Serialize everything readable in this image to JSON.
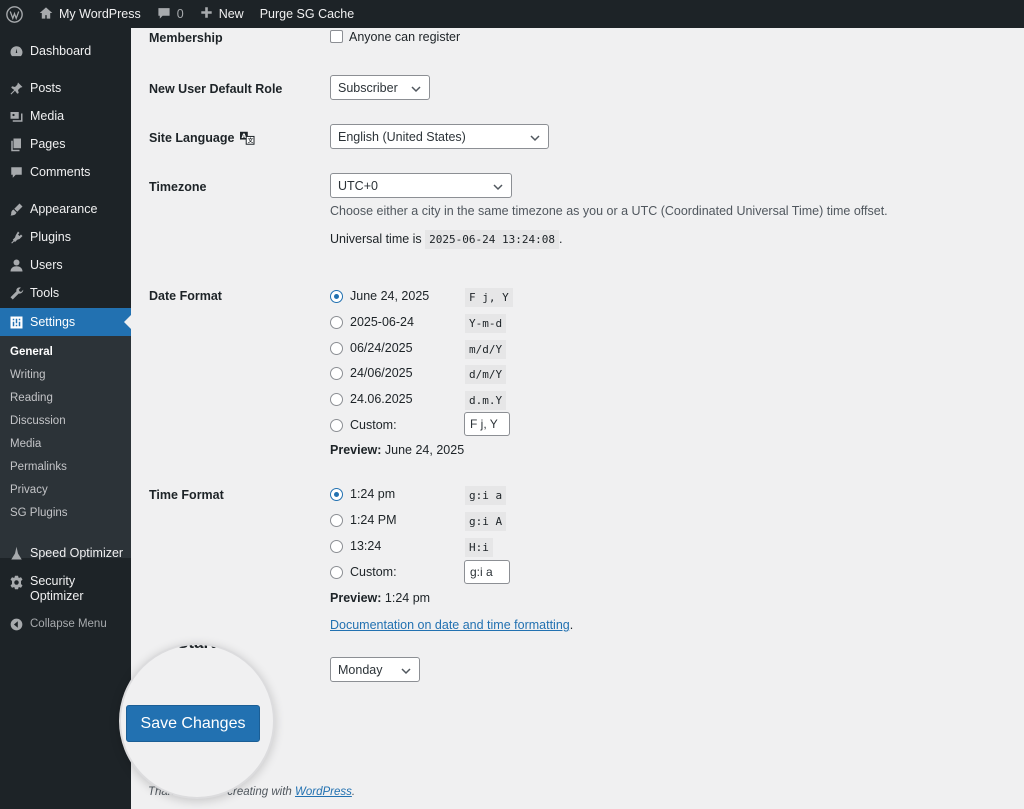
{
  "admin_bar": {
    "site_name": "My WordPress",
    "comments_count": "0",
    "new_label": "New",
    "purge_label": "Purge SG Cache"
  },
  "sidebar": {
    "menu": {
      "dashboard": "Dashboard",
      "posts": "Posts",
      "media": "Media",
      "pages": "Pages",
      "comments": "Comments",
      "appearance": "Appearance",
      "plugins": "Plugins",
      "users": "Users",
      "tools": "Tools",
      "settings": "Settings",
      "speed_optimizer": "Speed Optimizer",
      "security_optimizer_line1": "Security",
      "security_optimizer_line2": "Optimizer",
      "collapse": "Collapse Menu"
    },
    "submenu": {
      "general": "General",
      "writing": "Writing",
      "reading": "Reading",
      "discussion": "Discussion",
      "media": "Media",
      "permalinks": "Permalinks",
      "privacy": "Privacy",
      "sg_plugins": "SG Plugins"
    }
  },
  "settings": {
    "membership": {
      "label": "Membership",
      "checkbox_label": "Anyone can register"
    },
    "default_role": {
      "label": "New User Default Role",
      "value": "Subscriber"
    },
    "site_language": {
      "label": "Site Language",
      "value": "English (United States)"
    },
    "timezone": {
      "label": "Timezone",
      "value": "UTC+0",
      "description": "Choose either a city in the same timezone as you or a UTC (Coordinated Universal Time) time offset.",
      "universal_prefix": "Universal time is",
      "universal_time": "2025-06-24 13:24:08",
      "universal_suffix": "."
    },
    "date_format": {
      "label": "Date Format",
      "options": [
        {
          "label": "June 24, 2025",
          "code": "F j, Y"
        },
        {
          "label": "2025-06-24",
          "code": "Y-m-d"
        },
        {
          "label": "06/24/2025",
          "code": "m/d/Y"
        },
        {
          "label": "24/06/2025",
          "code": "d/m/Y"
        },
        {
          "label": "24.06.2025",
          "code": "d.m.Y"
        }
      ],
      "custom_label": "Custom:",
      "custom_value": "F j, Y",
      "preview_label": "Preview:",
      "preview_value": "June 24, 2025"
    },
    "time_format": {
      "label": "Time Format",
      "options": [
        {
          "label": "1:24 pm",
          "code": "g:i a"
        },
        {
          "label": "1:24 PM",
          "code": "g:i A"
        },
        {
          "label": "13:24",
          "code": "H:i"
        }
      ],
      "custom_label": "Custom:",
      "custom_value": "g:i a",
      "preview_label": "Preview:",
      "preview_value": "1:24 pm",
      "doc_link": "Documentation on date and time formatting",
      "doc_link_suffix": "."
    },
    "week_start": {
      "label_partial": "Start",
      "value": "Monday"
    }
  },
  "save_button": "Save Changes",
  "footer": {
    "prefix": "Than",
    "middle": "r creating with ",
    "link": "WordPress",
    "suffix": "."
  },
  "colors": {
    "accent": "#2271b1",
    "admin_dark": "#1d2327",
    "background": "#f0f0f1"
  }
}
